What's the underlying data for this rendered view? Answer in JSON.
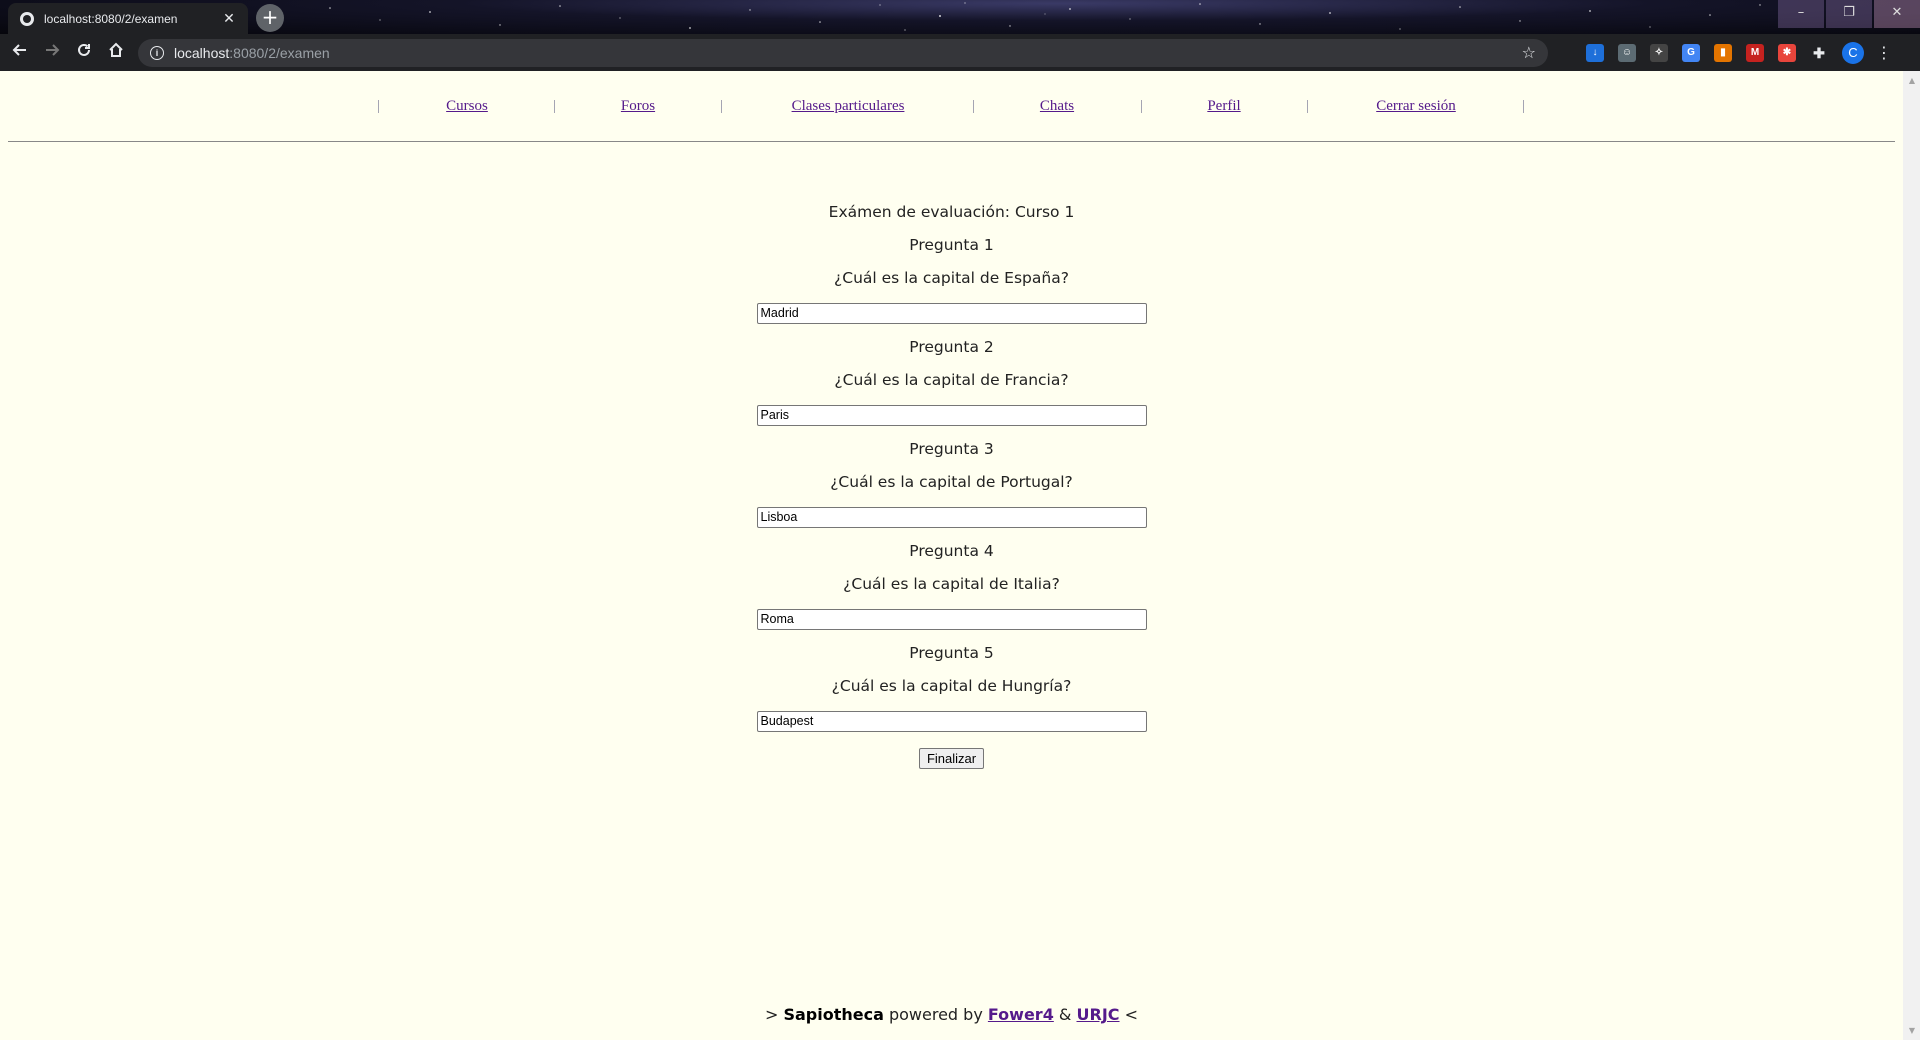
{
  "browser": {
    "tab_title": "localhost:8080/2/examen",
    "tab_close": "✕",
    "new_tab": "+",
    "url_host": "localhost",
    "url_path": ":8080/2/examen",
    "window_controls": {
      "minimize": "–",
      "maximize": "❐",
      "close": "✕"
    },
    "profile_initial": "C"
  },
  "nav": {
    "separator": "|",
    "links": [
      "Cursos",
      "Foros",
      "Clases particulares",
      "Chats",
      "Perfil",
      "Cerrar sesión"
    ]
  },
  "exam": {
    "title": "Exámen de evaluación: Curso 1",
    "questions": [
      {
        "label": "Pregunta 1",
        "text": "¿Cuál es la capital de España?",
        "answer": "Madrid"
      },
      {
        "label": "Pregunta 2",
        "text": "¿Cuál es la capital de Francia?",
        "answer": "Paris"
      },
      {
        "label": "Pregunta 3",
        "text": "¿Cuál es la capital de Portugal?",
        "answer": "Lisboa"
      },
      {
        "label": "Pregunta 4",
        "text": "¿Cuál es la capital de Italia?",
        "answer": "Roma"
      },
      {
        "label": "Pregunta 5",
        "text": "¿Cuál es la capital de Hungría?",
        "answer": "Budapest"
      }
    ],
    "submit_label": "Finalizar"
  },
  "footer": {
    "prefix": ">",
    "brand": "Sapiotheca",
    "powered_by": "powered by",
    "link1": "Fower4",
    "amp": "&",
    "link2": "URJC",
    "suffix": "<"
  },
  "colors": {
    "page_background": "#fffff0",
    "visited_link": "#551a8b",
    "chrome_dark": "#202124"
  }
}
